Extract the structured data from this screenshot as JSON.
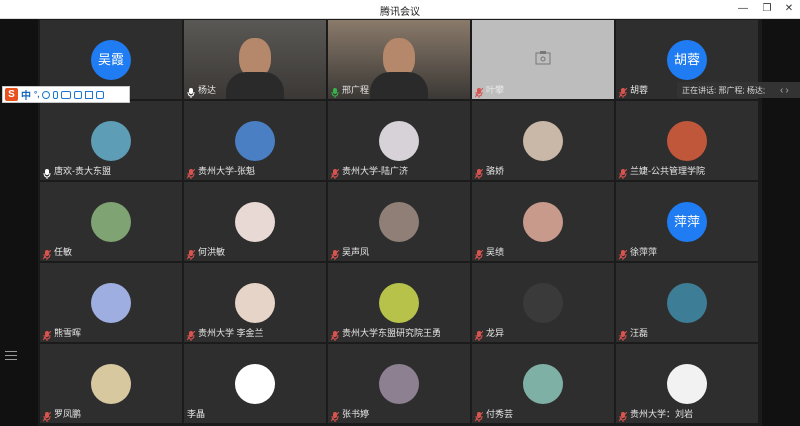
{
  "window": {
    "title": "腾讯会议",
    "minimize": "—",
    "restore": "❐",
    "close": "✕"
  },
  "speaking": {
    "text": "正在讲话: 邢广程; 杨达;",
    "prev_icon": "chevron-left-icon",
    "next_icon": "chevron-right-icon"
  },
  "ime": {
    "logo": "S",
    "mode": "中",
    "punct": "°,",
    "icons": [
      "emoji-icon",
      "voice-icon",
      "keyboard-icon",
      "toolbox-icon",
      "skin-icon",
      "grid-icon"
    ]
  },
  "colors": {
    "muted_mic": "#d9534f",
    "active_border": "#38b24a",
    "initial_avatar": "#1f7cf2",
    "tile": "#2e2e2e"
  },
  "participants": [
    {
      "name": "",
      "initial": "吴霞",
      "mic": "none",
      "type": "initial"
    },
    {
      "name": "杨达",
      "mic": "on",
      "type": "video"
    },
    {
      "name": "邢广程",
      "mic": "speaking",
      "type": "video",
      "active": true
    },
    {
      "name": "叶攀",
      "mic": "muted",
      "type": "camera-off"
    },
    {
      "name": "胡蓉",
      "initial": "胡蓉",
      "mic": "muted",
      "type": "initial"
    },
    {
      "name": "唐欢-贵大东盟",
      "mic": "on",
      "type": "photo",
      "color": "#5d9db5"
    },
    {
      "name": "贵州大学-张魁",
      "mic": "muted",
      "type": "photo",
      "color": "#4a7fc4"
    },
    {
      "name": "贵州大学-陆广济",
      "mic": "muted",
      "type": "photo",
      "color": "#d6d2d8"
    },
    {
      "name": "骆娇",
      "mic": "muted",
      "type": "photo",
      "color": "#c9b8a8"
    },
    {
      "name": "兰婕-公共管理学院",
      "mic": "muted",
      "type": "photo",
      "color": "#c0573b"
    },
    {
      "name": "任敏",
      "mic": "muted",
      "type": "photo",
      "color": "#7fa372"
    },
    {
      "name": "何洪敏",
      "mic": "muted",
      "type": "photo",
      "color": "#e8d9d4"
    },
    {
      "name": "吴声凤",
      "mic": "muted",
      "type": "photo",
      "color": "#8f7f77"
    },
    {
      "name": "吴绩",
      "mic": "muted",
      "type": "photo",
      "color": "#c89a8c"
    },
    {
      "name": "徐萍萍",
      "initial": "萍萍",
      "mic": "muted",
      "type": "initial"
    },
    {
      "name": "熊雪晖",
      "mic": "muted",
      "type": "photo",
      "color": "#9eaee0"
    },
    {
      "name": "贵州大学 李金兰",
      "mic": "muted",
      "type": "photo",
      "color": "#e6d4c8"
    },
    {
      "name": "贵州大学东盟研究院王勇",
      "mic": "muted",
      "type": "photo",
      "color": "#b7c24a"
    },
    {
      "name": "龙异",
      "mic": "muted",
      "type": "photo",
      "color": "#3a3a3a"
    },
    {
      "name": "汪磊",
      "mic": "muted",
      "type": "photo",
      "color": "#3d7e96"
    },
    {
      "name": "罗凤鹏",
      "mic": "muted",
      "type": "photo",
      "color": "#d8c8a0"
    },
    {
      "name": "李晶",
      "mic": "none",
      "type": "photo",
      "color": "#ffffff"
    },
    {
      "name": "张书婷",
      "mic": "muted",
      "type": "photo",
      "color": "#8d8090"
    },
    {
      "name": "付秀芸",
      "mic": "muted",
      "type": "photo",
      "color": "#7fb0a5"
    },
    {
      "name": "贵州大学：刘岩",
      "mic": "muted",
      "type": "photo",
      "color": "#f2f2f2"
    }
  ]
}
